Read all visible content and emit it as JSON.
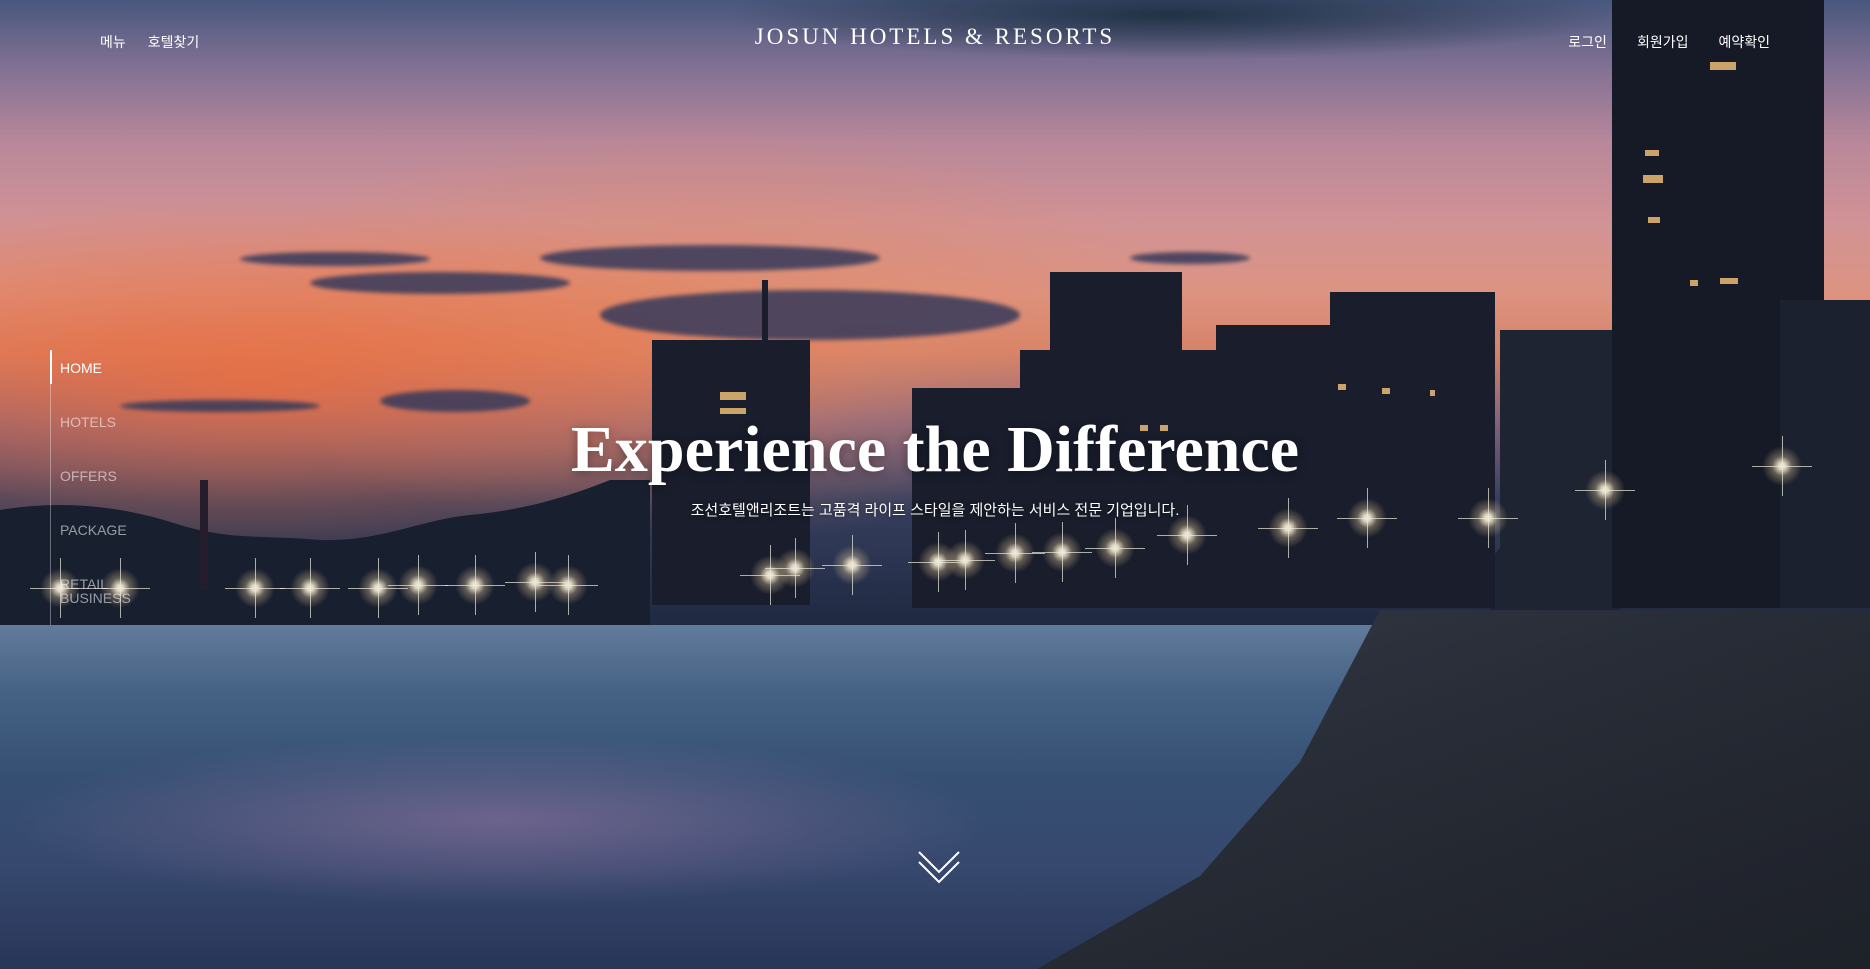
{
  "header": {
    "logo": "JOSUN HOTELS & RESORTS",
    "left_nav": [
      "메뉴",
      "호텔찾기"
    ],
    "right_nav": [
      "로그인",
      "회원가입",
      "예약확인"
    ]
  },
  "side_nav": {
    "items": [
      "HOME",
      "HOTELS",
      "OFFERS",
      "PACKAGE",
      "RETAIL",
      "BUSINESS"
    ],
    "active": "HOME"
  },
  "hero": {
    "headline": "Experience the Difference",
    "subline": "조선호텔앤리조트는 고품격 라이프 스타일을 제안하는 서비스 전문 기업입니다."
  },
  "icons": {
    "scroll": "chevron-down-icon"
  },
  "colors": {
    "text": "#ffffff",
    "sky_orange": "#e98e72",
    "sea_blue": "#3a567d"
  }
}
